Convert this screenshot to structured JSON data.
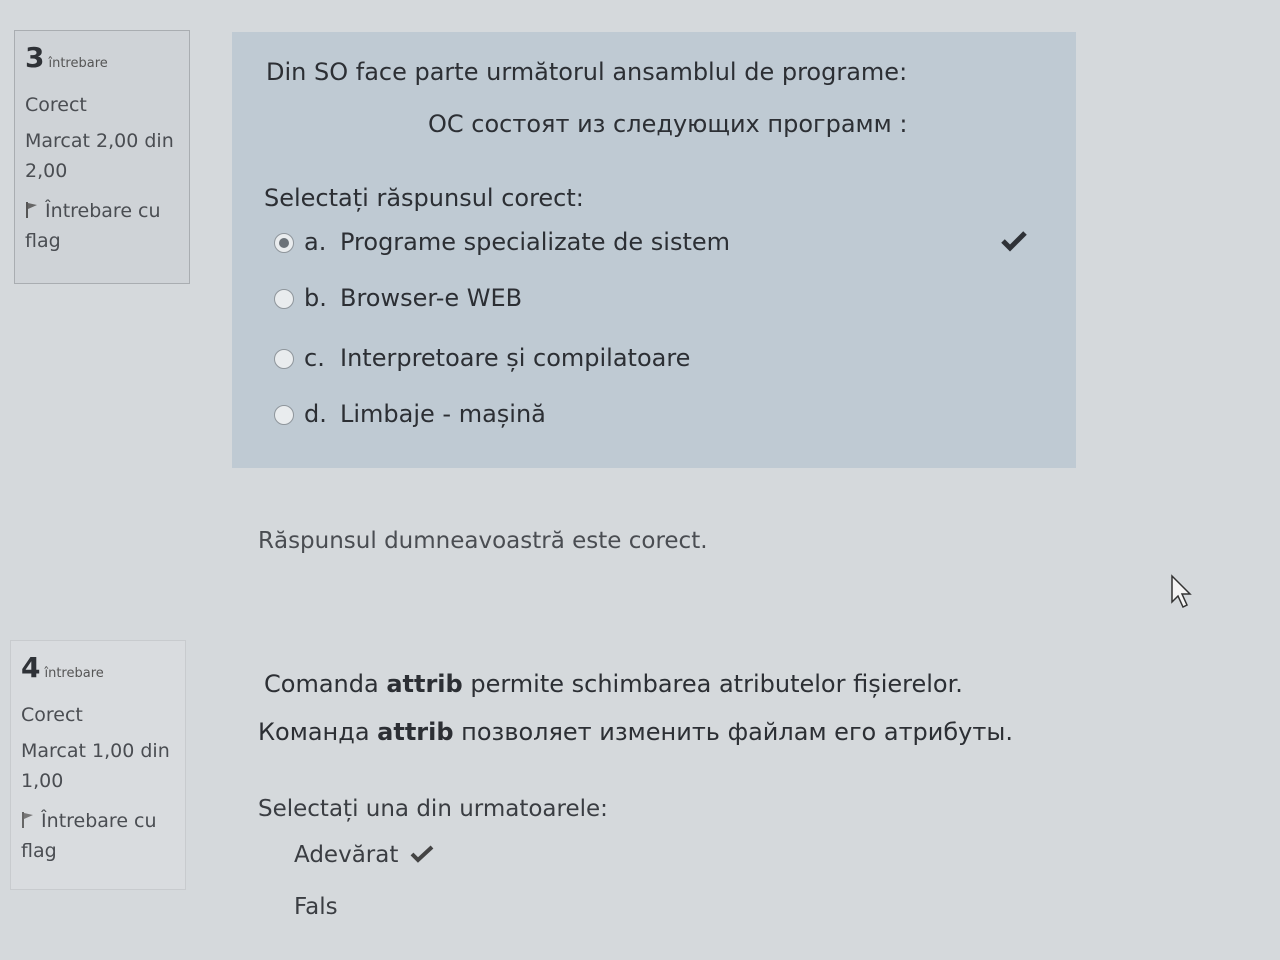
{
  "q3": {
    "info": {
      "number": "3",
      "label": "întrebare",
      "status": "Corect",
      "mark": "Marcat 2,00 din 2,00",
      "flag": "Întrebare cu flag"
    },
    "text_ro": "Din SO face parte următorul ansamblul de programe:",
    "text_ru": "ОС состоят из следующих программ :",
    "prompt": "Selectați răspunsul corect:",
    "options": [
      {
        "letter": "a.",
        "text": "Programe specializate de sistem",
        "selected": true,
        "correct": true
      },
      {
        "letter": "b.",
        "text": "Browser-e  WEB",
        "selected": false
      },
      {
        "letter": "c.",
        "text": "Interpretoare și compilatoare",
        "selected": false
      },
      {
        "letter": "d.",
        "text": "Limbaje - mașină",
        "selected": false
      }
    ],
    "feedback": "Răspunsul dumneavoastră este corect."
  },
  "q4": {
    "info": {
      "number": "4",
      "label": "întrebare",
      "status": "Corect",
      "mark": "Marcat 1,00 din 1,00",
      "flag": "Întrebare cu flag"
    },
    "text_ro": {
      "before": "Comanda ",
      "bold": "attrib",
      "after": " permite schimbarea atributelor fișierelor."
    },
    "text_ru": {
      "before": "Команда ",
      "bold": "attrib",
      "after": " позволяет изменить файлам его атрибуты."
    },
    "prompt": "Selectați una din urmatoarele:",
    "options": [
      {
        "text": "Adevărat",
        "correct": true
      },
      {
        "text": "Fals"
      }
    ]
  },
  "icons": [
    "flag-icon",
    "check-icon",
    "mouse-cursor-icon"
  ]
}
